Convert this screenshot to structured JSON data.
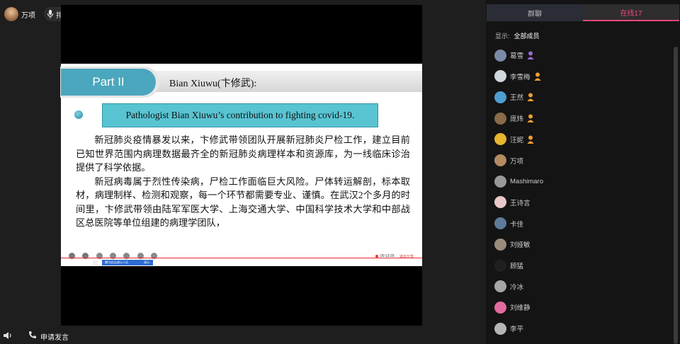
{
  "host": {
    "name": "万项"
  },
  "mic_button": {
    "label": "排麦"
  },
  "slide": {
    "part_label": "Part II",
    "title": "Bian Xiuwu(卞修武):",
    "subtitle": "Pathologist Bian Xiuwu’s contribution to fighting covid-19.",
    "paragraph1": "新冠肺炎疫情暴发以来，卞修武带领团队开展新冠肺炎尸检工作，建立目前已知世界范围内病理数据最齐全的新冠肺炎病理样本和资源库，为一线临床诊治提供了科学依据。",
    "paragraph2": "新冠病毒属于烈性传染病，尸检工作面临巨大风险。尸体转运解剖，标本取材，病理制样、检测和观察，每一个环节都需要专业、谨慎。在武汉2个多月的时间里，卞修武带领由陆军军医大学、上海交通大学、中国科学技术大学和中部战区总医院等单位组建的病理学团队，"
  },
  "share_toolbar": {
    "timer": "00:13:29",
    "stop_share": "退出分享"
  },
  "taskbar": {
    "item1": "腾讯会议|演示人员",
    "item2": "演示"
  },
  "bottom_bar": {
    "apply_speak": "申请发言"
  },
  "panel": {
    "tabs": [
      {
        "label": "群聊"
      },
      {
        "label": "在线17"
      }
    ],
    "filter_label": "显示:",
    "filter_value": "全部成员",
    "members": [
      {
        "name": "葛雪",
        "avatar_color": "#7b8aa6",
        "badge": "purple"
      },
      {
        "name": "李雪梅",
        "avatar_color": "#cfd7df",
        "badge": "orange"
      },
      {
        "name": "王然",
        "avatar_color": "#4e9fd1",
        "badge": "orange"
      },
      {
        "name": "庞炜",
        "avatar_color": "#8a6a4a",
        "badge": "orange"
      },
      {
        "name": "汪妮",
        "avatar_color": "#e8b52e",
        "badge": "orange"
      },
      {
        "name": "万项",
        "avatar_color": "#b48a63",
        "badge": ""
      },
      {
        "name": "Mashimaro",
        "avatar_color": "#999999",
        "badge": ""
      },
      {
        "name": "王诗言",
        "avatar_color": "#e8c8c8",
        "badge": ""
      },
      {
        "name": "卡佳",
        "avatar_color": "#5d7a9a",
        "badge": ""
      },
      {
        "name": "刘娅敏",
        "avatar_color": "#9b8b7a",
        "badge": ""
      },
      {
        "name": "顾猛",
        "avatar_color": "#202020",
        "badge": ""
      },
      {
        "name": "冷冰",
        "avatar_color": "#a6a6a6",
        "badge": ""
      },
      {
        "name": "刘维静",
        "avatar_color": "#e36aa0",
        "badge": ""
      },
      {
        "name": "李平",
        "avatar_color": "#b5b5b5",
        "badge": ""
      }
    ]
  },
  "colors": {
    "accent": "#e8497a",
    "part_pill": "#4aa7bd",
    "subtitle_box": "#58c4d2"
  }
}
